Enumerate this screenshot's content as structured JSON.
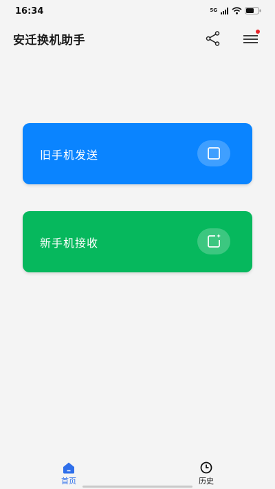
{
  "status_bar": {
    "time": "16:34",
    "network_label": "5G"
  },
  "header": {
    "title": "安迁换机助手",
    "share_icon": "share-icon",
    "menu_icon": "menu-icon",
    "menu_badge_color": "#e8242a"
  },
  "cards": {
    "send": {
      "label": "旧手机发送",
      "icon": "old-phone-icon",
      "color": "#0a84ff"
    },
    "receive": {
      "label": "新手机接收",
      "icon": "new-phone-icon",
      "color": "#06b85d"
    }
  },
  "bottom_nav": {
    "items": [
      {
        "label": "首页",
        "icon": "home-icon",
        "active": true
      },
      {
        "label": "历史",
        "icon": "clock-icon",
        "active": false
      }
    ],
    "active_color": "#2f6fea"
  }
}
